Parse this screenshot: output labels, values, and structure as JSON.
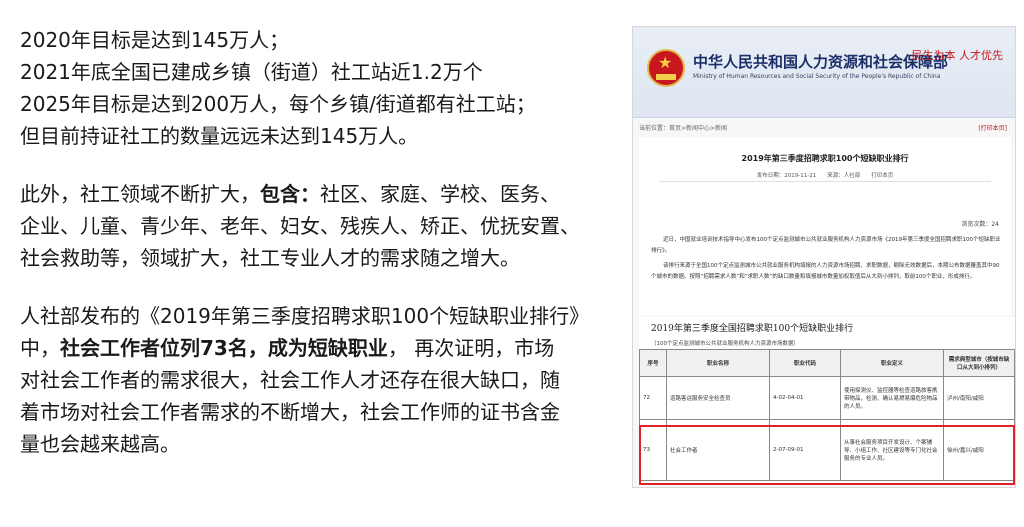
{
  "text": {
    "p1": [
      "2020年目标是达到145万人；",
      "2021年底全国已建成乡镇（街道）社工站近1.2万个",
      "2025年目标是达到200万人，每个乡镇/街道都有社工站；",
      "但目前持证社工的数量远远未达到145万人。"
    ],
    "p2": {
      "l1_a": "此外，社工领域不断扩大，",
      "l1_b": "包含：",
      "l1_c": "社区、家庭、学校、医务、",
      "l2": "企业、儿童、青少年、老年、妇女、残疾人、矫正、优抚安置、",
      "l3": "社会救助等，领域扩大，社工专业人才的需求随之增大。"
    },
    "p3": {
      "l1": "人社部发布的《2019年第三季度招聘求职100个短缺职业排行》",
      "l2_a": "中，",
      "l2_b": "社会工作者位列73名，成为短缺职业",
      "l2_c": "， 再次证明，市场",
      "l3": "对社会工作者的需求很大，社会工作人才还存在很大缺口，随",
      "l4": "着市场对社会工作者需求的不断增大，社会工作师的证书含金",
      "l5": "量也会越来越高。"
    }
  },
  "screenshot": {
    "ministry_cn": "中华人民共和国人力资源和社会保障部",
    "ministry_en": "Ministry of Human Resources and Social Security of the People's Republic of China",
    "slogan": "民生为本 人才优先",
    "breadcrumb": "当前位置：首页>新闻中心>新闻",
    "print_link": "[打印本页]",
    "article_title": "2019年第三季度招聘求职100个短缺职业排行",
    "article_meta": "发布日期：2019-11-21　　来源：人社部　　打印本页",
    "views": "浏览次数：24",
    "body": [
      "近日，中国就业培训技术指导中心发布100个定点监测城市公共就业服务机构人力资源市场《2019年第三季度全国招聘求职100个短缺职业排行》。",
      "该排行来源于全国100个定点监测城市公共就业服务机构填报的人力资源市场招聘、求职数据，剔除无效数据后，本期公布数据覆盖其中90个城市的数据。按照“招聘需求人数”和“求职人数”的缺口数量和填报城市数量加权取值后从大到小排列，取前100个职业，形成排行。"
    ],
    "table_title": "2019年第三季度全国招聘求职100个短缺职业排行",
    "table_subtitle": "（100个定点监测城市公共就业服务机构人力资源市场数据）",
    "columns": [
      "序号",
      "职业名称",
      "职业代码",
      "职业定义",
      "需求典型城市（按城市缺口从大到小排列）"
    ],
    "rows": [
      [
        "72",
        "道路客运服务安全检查员",
        "4-02-04-01",
        "使用探测仪、监控器等检查道路旅客携带物品，检测、确认易燃易爆危险物品的人员。",
        "泸州/南阳/咸阳"
      ],
      [
        "73",
        "社会工作者",
        "2-07-09-01",
        "从事社会服务项目开发设计、个案辅导、小组工作、社区建设等专门化社会服务的专业人员。",
        "徐州/嘉兴/咸阳"
      ]
    ]
  }
}
